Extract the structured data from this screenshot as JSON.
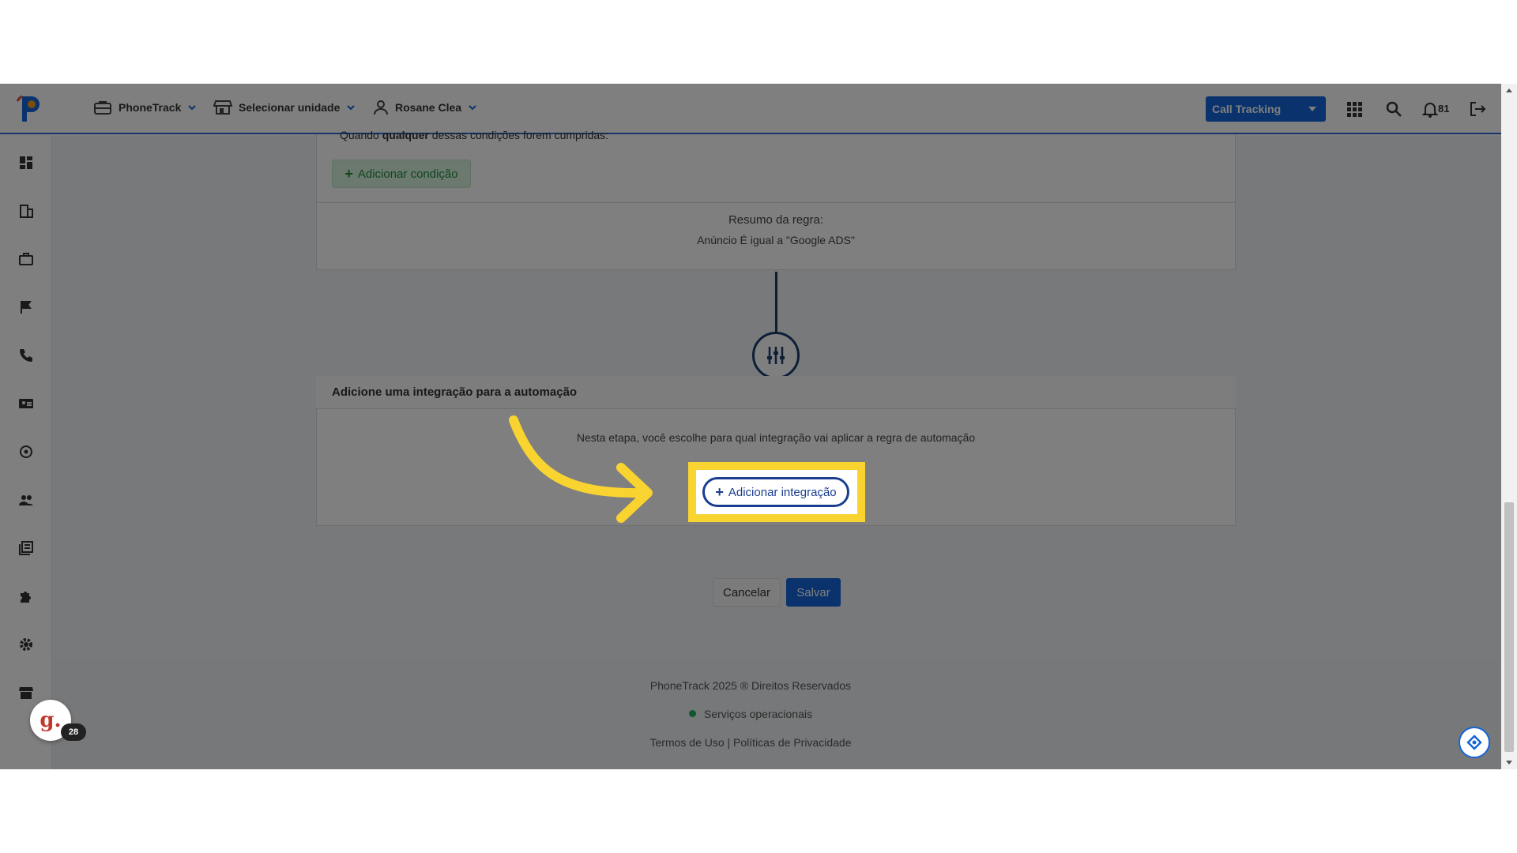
{
  "header": {
    "nav": [
      {
        "label": "PhoneTrack",
        "icon": "briefcase-icon"
      },
      {
        "label": "Selecionar unidade",
        "icon": "store-icon"
      },
      {
        "label": "Rosane Clea",
        "icon": "user-icon"
      }
    ],
    "product_select": "Call Tracking",
    "notification_count": "81"
  },
  "sidebar": {
    "items": [
      {
        "icon": "dashboard-icon"
      },
      {
        "icon": "building-icon"
      },
      {
        "icon": "briefcase-icon"
      },
      {
        "icon": "flag-icon"
      },
      {
        "icon": "phone-icon"
      },
      {
        "icon": "contact-card-icon"
      },
      {
        "icon": "target-icon"
      },
      {
        "icon": "users-icon"
      },
      {
        "icon": "reports-icon"
      },
      {
        "icon": "puzzle-icon"
      },
      {
        "icon": "gear-icon"
      },
      {
        "icon": "store-icon"
      }
    ]
  },
  "rule": {
    "condition_prefix": "Quando ",
    "condition_bold": "qualquer",
    "condition_suffix": " dessas condições forem cumpridas:",
    "add_condition_label": "Adicionar condição",
    "summary_title": "Resumo da regra:",
    "summary_text": "Anúncio É igual a \"Google ADS\""
  },
  "integration": {
    "header": "Adicione uma integração para a automação",
    "description": "Nesta etapa, você escolhe para qual integração vai aplicar a regra de automação",
    "add_label": "Adicionar integração"
  },
  "actions": {
    "cancel_label": "Cancelar",
    "save_label": "Salvar"
  },
  "footer": {
    "copyright": "PhoneTrack 2025 ® Direitos Reservados",
    "status": "Serviços operacionais",
    "links": "Termos de Uso | Políticas de Privacidade"
  },
  "chat": {
    "logo_letter": "g.",
    "badge": "28"
  },
  "colors": {
    "brand_blue": "#1565d8",
    "navy": "#1a3d8f",
    "highlight_yellow": "#f9d330",
    "status_green": "#27ae60"
  }
}
